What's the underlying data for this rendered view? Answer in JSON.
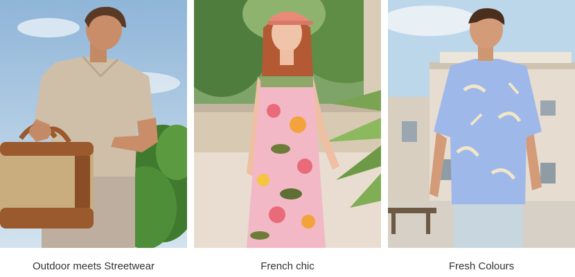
{
  "categories": [
    {
      "label": "Outdoor meets Streetwear",
      "image": "man-in-beige-knit-polo-carrying-canvas-leather-holdall-bag-with-trees-and-sky"
    },
    {
      "label": "French chic",
      "image": "smiling-woman-in-pink-floral-slip-dress-and-pink-cap-among-palm-leaves"
    },
    {
      "label": "Fresh Colours",
      "image": "man-in-blue-palm-print-short-sleeve-shirt-in-front-of-historic-building"
    }
  ],
  "colors": {
    "caption_text": "#333333",
    "background": "#ffffff",
    "sky": "#b9d4e8",
    "polo": "#cfbfa8",
    "bag_canvas": "#c9ad7f",
    "bag_leather": "#9a5a2e",
    "dress_pink": "#f2b8c6",
    "cap_pink": "#e98a78",
    "shirt_blue": "#9fb8ea",
    "building": "#e6ddd0"
  }
}
